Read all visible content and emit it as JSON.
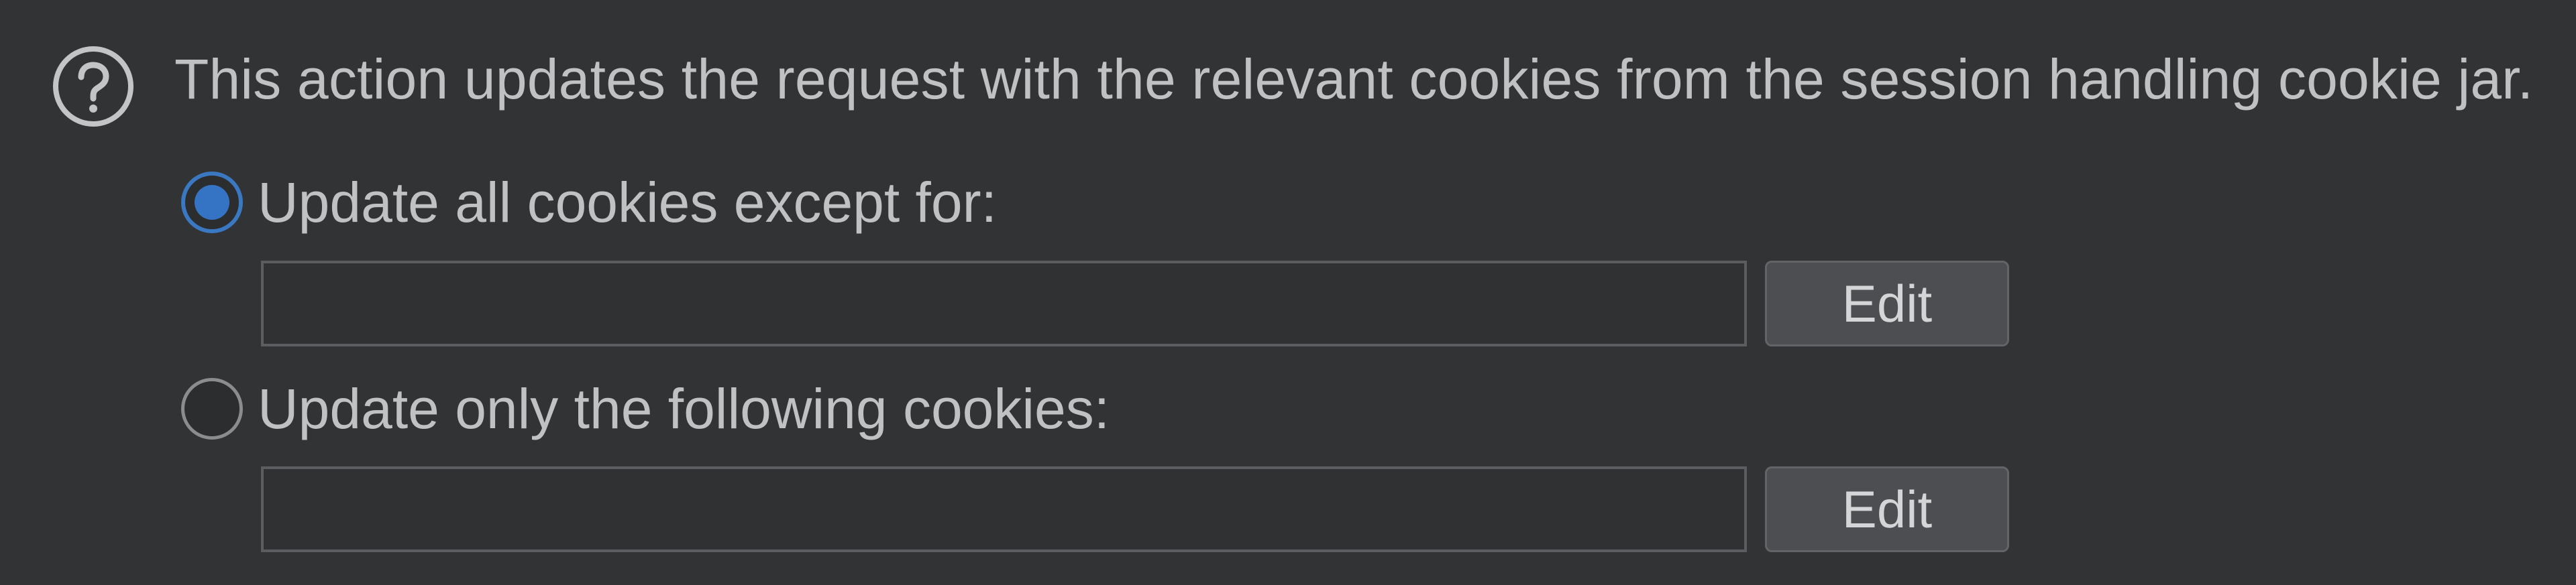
{
  "description": "This action updates the request with the relevant cookies from the session handling cookie jar.",
  "help_icon": "question-circle-icon",
  "options": [
    {
      "label": "Update all cookies except for:",
      "selected": true,
      "field_value": "",
      "edit_label": "Edit"
    },
    {
      "label": "Update only the following cookies:",
      "selected": false,
      "field_value": "",
      "edit_label": "Edit"
    }
  ],
  "colors": {
    "background": "#323335",
    "text": "#bfc1c3",
    "accent": "#3574c5",
    "field_border": "#5b5d60",
    "button_bg": "#4c4e51"
  }
}
